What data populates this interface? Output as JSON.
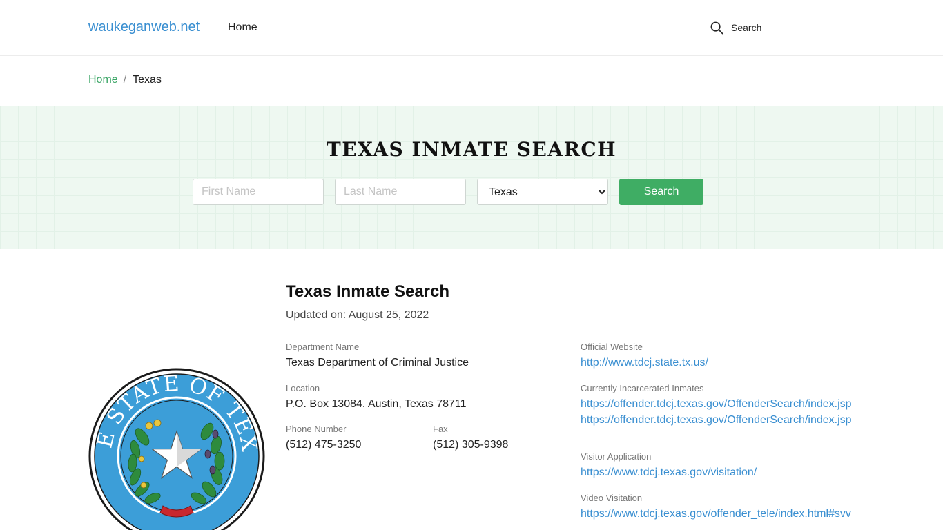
{
  "header": {
    "brand": "waukeganweb.net",
    "nav_home": "Home",
    "search_label": "Search"
  },
  "breadcrumb": {
    "home": "Home",
    "separator": "/",
    "current": "Texas"
  },
  "hero": {
    "title": "TEXAS INMATE SEARCH",
    "first_name_placeholder": "First Name",
    "last_name_placeholder": "Last Name",
    "state_selected": "Texas",
    "search_button": "Search"
  },
  "seal": {
    "text": "THE STATE OF TEXAS"
  },
  "main": {
    "title": "Texas Inmate Search",
    "updated": "Updated on: August 25, 2022",
    "department_label": "Department Name",
    "department_value": "Texas Department of Criminal Justice",
    "location_label": "Location",
    "location_value": "P.O. Box 13084. Austin, Texas 78711",
    "phone_label": "Phone Number",
    "phone_value": "(512) 475-3250",
    "fax_label": "Fax",
    "fax_value": "(512) 305-9398",
    "website_label": "Official Website",
    "website_value": "http://www.tdcj.state.tx.us/",
    "incarcerated_label": "Currently Incarcerated Inmates",
    "incarcerated_value": "https://offender.tdcj.texas.gov/OffenderSearch/index.jsp",
    "extra_link": "https://offender.tdcj.texas.gov/OffenderSearch/index.jsp",
    "visitor_label": "Visitor Application",
    "visitor_value": "https://www.tdcj.texas.gov/visitation/",
    "video_label": "Video Visitation",
    "video_value": "https://www.tdcj.texas.gov/offender_tele/index.html#svv"
  },
  "colors": {
    "brand": "#3a8fd1",
    "accent_green": "#3fad64",
    "link": "#3a8fd1",
    "hero_bg": "#eef8f1",
    "seal_blue": "#3c9ed8"
  }
}
